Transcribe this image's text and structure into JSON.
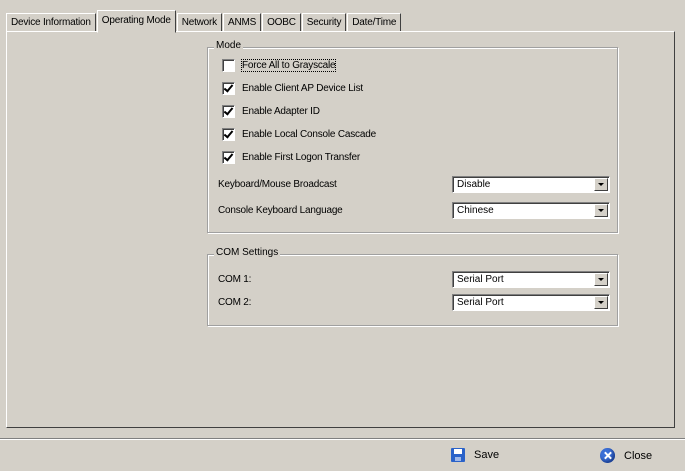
{
  "tabs": [
    {
      "label": "Device Information"
    },
    {
      "label": "Operating Mode",
      "active": true
    },
    {
      "label": "Network"
    },
    {
      "label": "ANMS"
    },
    {
      "label": "OOBC"
    },
    {
      "label": "Security"
    },
    {
      "label": "Date/Time"
    }
  ],
  "mode": {
    "title": "Mode",
    "checkboxes": [
      {
        "label": "Force All to Grayscale",
        "checked": false
      },
      {
        "label": "Enable Client AP Device List",
        "checked": true
      },
      {
        "label": "Enable Adapter ID",
        "checked": true
      },
      {
        "label": "Enable Local Console Cascade",
        "checked": true
      },
      {
        "label": "Enable First Logon Transfer",
        "checked": true
      }
    ],
    "broadcast": {
      "label": "Keyboard/Mouse Broadcast",
      "value": "Disable"
    },
    "language": {
      "label": "Console Keyboard Language",
      "value": "Chinese"
    }
  },
  "com": {
    "title": "COM Settings",
    "com1": {
      "label": "COM 1:",
      "value": "Serial Port"
    },
    "com2": {
      "label": "COM 2:",
      "value": "Serial Port"
    }
  },
  "actions": {
    "save": "Save",
    "close": "Close"
  },
  "icons": {
    "save": "save-icon",
    "close": "close-icon"
  },
  "colors": {
    "background": "#d4d0c8",
    "icon_blue": "#2a62c9"
  }
}
